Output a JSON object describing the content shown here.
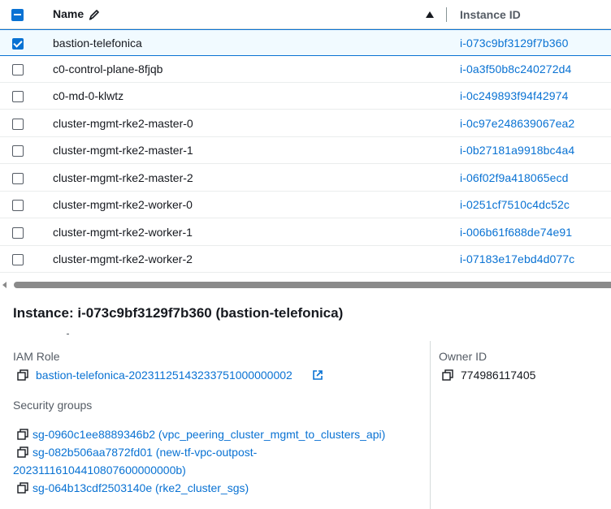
{
  "table": {
    "header": {
      "name_label": "Name",
      "id_label": "Instance ID"
    },
    "rows": [
      {
        "name": "bastion-telefonica",
        "id": "i-073c9bf3129f7b360",
        "checked": true
      },
      {
        "name": "c0-control-plane-8fjqb",
        "id": "i-0a3f50b8c240272d4",
        "checked": false
      },
      {
        "name": "c0-md-0-klwtz",
        "id": "i-0c249893f94f42974",
        "checked": false
      },
      {
        "name": "cluster-mgmt-rke2-master-0",
        "id": "i-0c97e248639067ea2",
        "checked": false
      },
      {
        "name": "cluster-mgmt-rke2-master-1",
        "id": "i-0b27181a9918bc4a4",
        "checked": false
      },
      {
        "name": "cluster-mgmt-rke2-master-2",
        "id": "i-06f02f9a418065ecd",
        "checked": false
      },
      {
        "name": "cluster-mgmt-rke2-worker-0",
        "id": "i-0251cf7510c4dc52c",
        "checked": false
      },
      {
        "name": "cluster-mgmt-rke2-worker-1",
        "id": "i-006b61f688de74e91",
        "checked": false
      },
      {
        "name": "cluster-mgmt-rke2-worker-2",
        "id": "i-07183e17ebd4d077c",
        "checked": false
      }
    ]
  },
  "details": {
    "title": "Instance: i-073c9bf3129f7b360 (bastion-telefonica)",
    "iam_role_label": "IAM Role",
    "iam_role_value": "bastion-telefonica-20231125143233751000000002",
    "owner_id_label": "Owner ID",
    "owner_id_value": "774986117405",
    "security_groups_label": "Security groups",
    "security_groups": [
      {
        "line1": "sg-0960c1ee8889346b2 (vpc_peering_cluster_mgmt_to_clusters_api)"
      },
      {
        "line1": "sg-082b506aa7872fd01 (new-tf-vpc-outpost-",
        "line2": "20231116104410807600000000b)"
      },
      {
        "line1": "sg-064b13cdf2503140e (rke2_cluster_sgs)"
      }
    ]
  },
  "colors": {
    "accent": "#0972d3",
    "text": "#16191f",
    "muted": "#545b64"
  },
  "icons": [
    "pencil-icon",
    "sort-ascending-icon",
    "copy-icon",
    "external-link-icon"
  ]
}
